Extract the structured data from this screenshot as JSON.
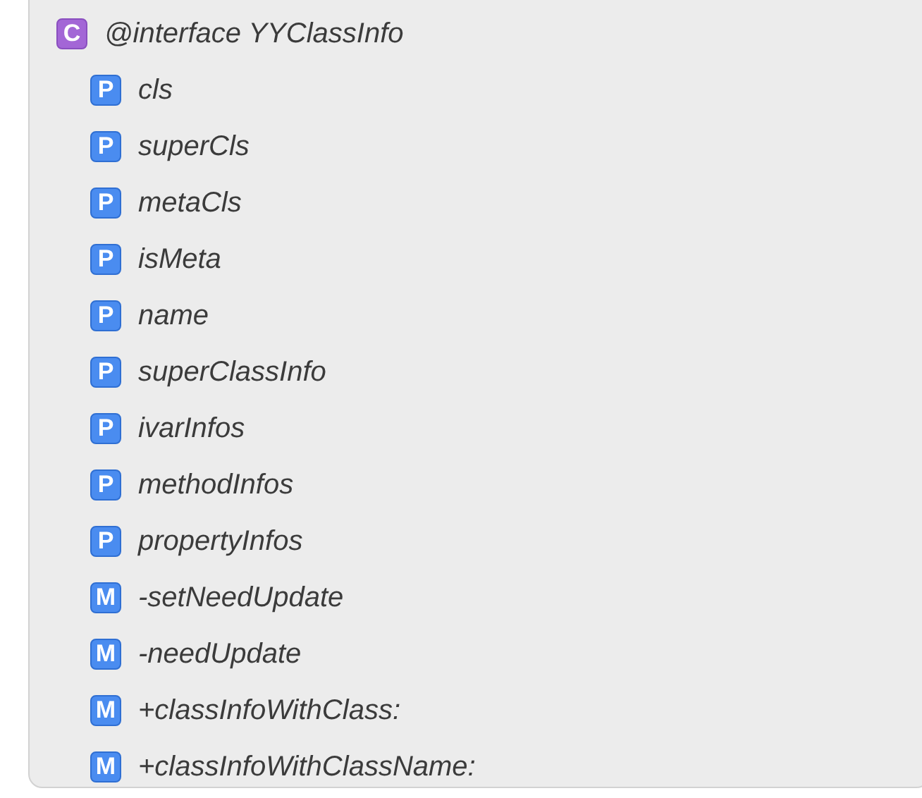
{
  "outline": {
    "badge": "C",
    "label": "@interface YYClassInfo",
    "children": [
      {
        "badge": "P",
        "label": "cls"
      },
      {
        "badge": "P",
        "label": "superCls"
      },
      {
        "badge": "P",
        "label": "metaCls"
      },
      {
        "badge": "P",
        "label": "isMeta"
      },
      {
        "badge": "P",
        "label": "name"
      },
      {
        "badge": "P",
        "label": "superClassInfo"
      },
      {
        "badge": "P",
        "label": "ivarInfos"
      },
      {
        "badge": "P",
        "label": "methodInfos"
      },
      {
        "badge": "P",
        "label": "propertyInfos"
      },
      {
        "badge": "M",
        "label": "-setNeedUpdate"
      },
      {
        "badge": "M",
        "label": "-needUpdate"
      },
      {
        "badge": "M",
        "label": "+classInfoWithClass:"
      },
      {
        "badge": "M",
        "label": "+classInfoWithClassName:"
      }
    ]
  }
}
